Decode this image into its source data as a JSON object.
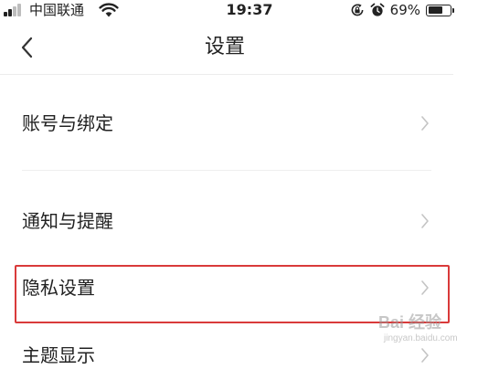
{
  "status_bar": {
    "carrier": "中国联通",
    "time": "19:37",
    "battery_percent": "69%",
    "battery_level": 0.69,
    "icons": [
      "signal-icon",
      "wifi-icon",
      "rotation-lock-icon",
      "alarm-icon",
      "battery-icon"
    ]
  },
  "nav": {
    "title": "设置",
    "back_icon": "chevron-left-icon"
  },
  "settings_items": [
    {
      "label": "账号与绑定"
    },
    {
      "label": "通知与提醒"
    },
    {
      "label": "隐私设置",
      "highlighted": true
    },
    {
      "label": "主题显示"
    }
  ],
  "colors": {
    "highlight_border": "#d93a3a",
    "divider": "#ececec",
    "text": "#222222",
    "chevron": "#c4c4c4"
  },
  "watermark": {
    "logo": "Bai 经验",
    "url": "jingyan.baidu.com"
  }
}
